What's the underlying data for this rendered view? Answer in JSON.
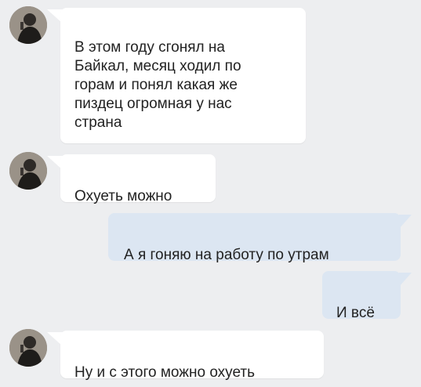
{
  "colors": {
    "background": "#edeef0",
    "incoming_bubble": "#ffffff",
    "outgoing_bubble": "#dce6f2",
    "text": "#222222"
  },
  "messages": [
    {
      "direction": "incoming",
      "text": "В этом году сгонял на\nБайкал, месяц ходил по\nгорам и понял какая же\nпиздец огромная у нас\nстрана",
      "avatar": "avatar-icon"
    },
    {
      "direction": "incoming",
      "text": "Охуеть можно",
      "avatar": "avatar-icon"
    },
    {
      "direction": "outgoing",
      "text": "А я гоняю на работу по утрам"
    },
    {
      "direction": "outgoing",
      "text": "И всё"
    },
    {
      "direction": "incoming",
      "text": "Ну и с этого можно охуеть",
      "avatar": "avatar-icon"
    }
  ]
}
